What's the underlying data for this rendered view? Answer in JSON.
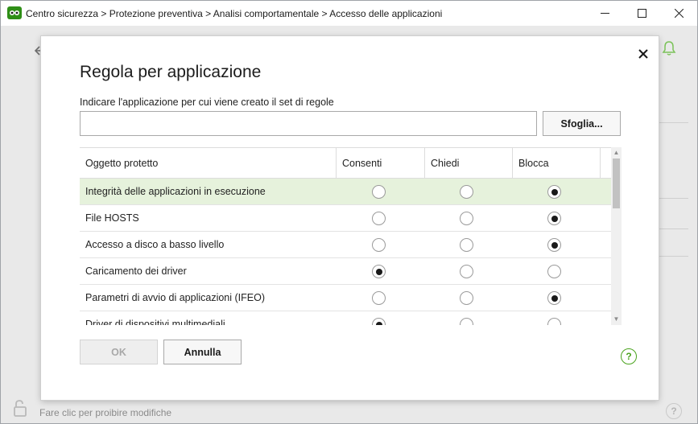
{
  "window": {
    "title": "Centro sicurezza > Protezione preventiva > Analisi comportamentale > Accesso delle applicazioni",
    "minimize": "—",
    "maximize": "☐",
    "close": "✕"
  },
  "background": {
    "footer_text": "Fare clic per proibire modifiche",
    "help": "?"
  },
  "dialog": {
    "title": "Regola per applicazione",
    "close": "✕",
    "field_label": "Indicare l'applicazione per cui viene creato il set di regole",
    "input_value": "",
    "browse_label": "Sfoglia...",
    "ok_label": "OK",
    "cancel_label": "Annulla",
    "help": "?"
  },
  "table": {
    "columns": [
      "Oggetto protetto",
      "Consenti",
      "Chiedi",
      "Blocca"
    ],
    "rows": [
      {
        "label": "Integrità delle applicazioni in esecuzione",
        "value": "Blocca",
        "selected": true
      },
      {
        "label": "File HOSTS",
        "value": "Blocca",
        "selected": false
      },
      {
        "label": "Accesso a disco a basso livello",
        "value": "Blocca",
        "selected": false
      },
      {
        "label": "Caricamento dei driver",
        "value": "Consenti",
        "selected": false
      },
      {
        "label": "Parametri di avvio di applicazioni (IFEO)",
        "value": "Blocca",
        "selected": false
      },
      {
        "label": "Driver di dispositivi multimediali",
        "value": "Consenti",
        "selected": false
      }
    ]
  },
  "colors": {
    "accent_green": "#4aa31e",
    "selected_row": "#e6f2dc"
  },
  "icons": {
    "app": "drweb-spider-icon",
    "back": "arrow-left-icon",
    "notifications": "bell-icon",
    "lock": "unlocked-padlock-icon",
    "help": "question-circle-icon"
  }
}
